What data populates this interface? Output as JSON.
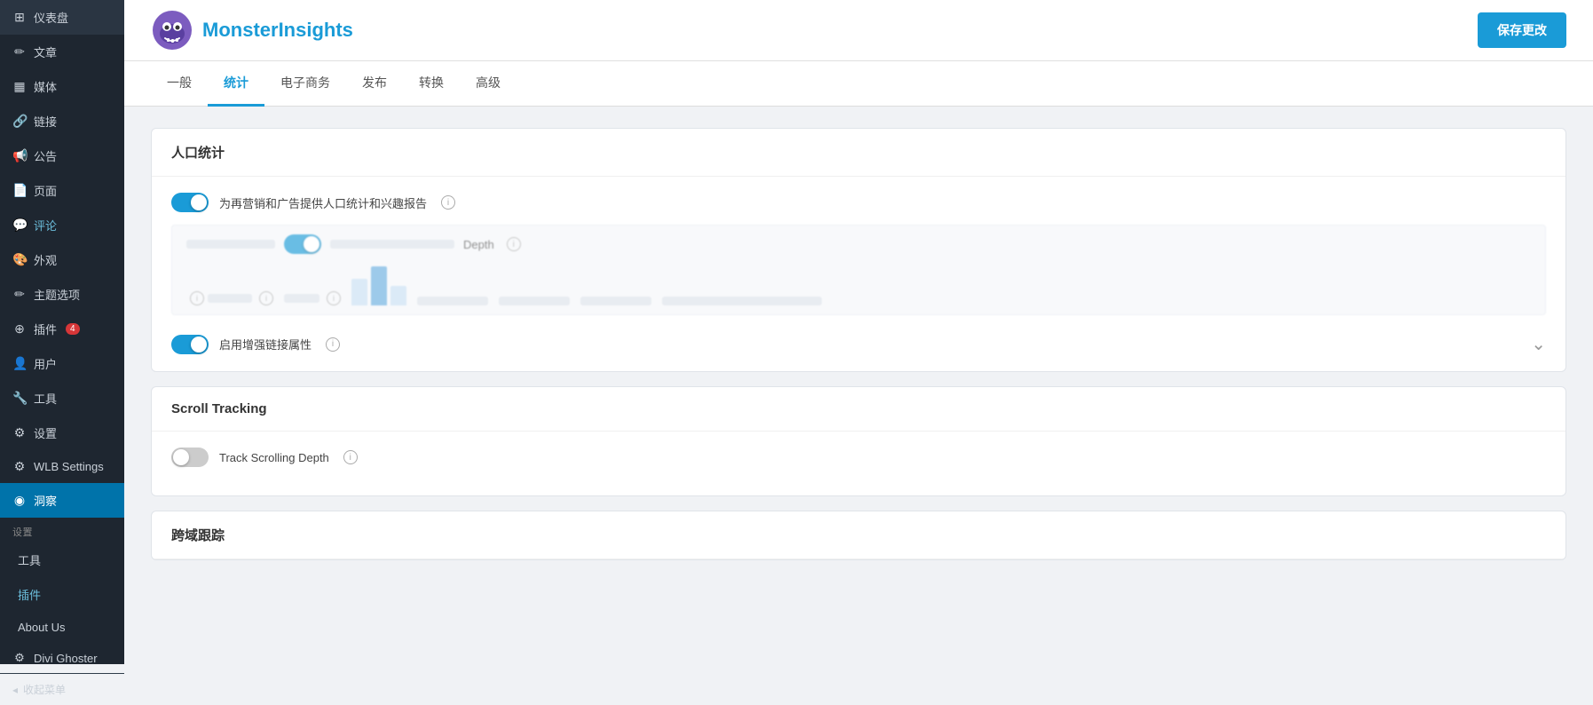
{
  "sidebar": {
    "items": [
      {
        "id": "dashboard",
        "label": "仪表盘",
        "icon": "⊞",
        "active": false
      },
      {
        "id": "articles",
        "label": "文章",
        "icon": "✏",
        "active": false
      },
      {
        "id": "media",
        "label": "媒体",
        "icon": "◫",
        "active": false
      },
      {
        "id": "links",
        "label": "链接",
        "icon": "🔗",
        "active": false
      },
      {
        "id": "announcements",
        "label": "公告",
        "icon": "📢",
        "active": false
      },
      {
        "id": "pages",
        "label": "页面",
        "icon": "📄",
        "active": false
      },
      {
        "id": "comments",
        "label": "评论",
        "icon": "💬",
        "active": false
      },
      {
        "id": "appearance",
        "label": "外观",
        "icon": "🎨",
        "active": false
      },
      {
        "id": "theme-options",
        "label": "主题选项",
        "icon": "✏",
        "active": false
      },
      {
        "id": "plugins",
        "label": "插件",
        "icon": "⊕",
        "badge": "4",
        "active": false
      },
      {
        "id": "users",
        "label": "用户",
        "icon": "👤",
        "active": false
      },
      {
        "id": "tools",
        "label": "工具",
        "icon": "🔧",
        "active": false
      },
      {
        "id": "settings",
        "label": "设置",
        "icon": "⚙",
        "active": false
      },
      {
        "id": "wlb-settings",
        "label": "WLB Settings",
        "icon": "⚙",
        "active": false
      },
      {
        "id": "insights",
        "label": "洞察",
        "icon": "◉",
        "active": true
      }
    ],
    "settings_section": "设置",
    "sub_items": [
      {
        "id": "tools-sub",
        "label": "工具"
      },
      {
        "id": "plugins-sub",
        "label": "插件"
      },
      {
        "id": "about-us",
        "label": "About Us"
      }
    ],
    "footer_items": [
      {
        "id": "divi-ghoster",
        "label": "Divi Ghoster",
        "icon": "⚙"
      },
      {
        "id": "collapse",
        "label": "收起菜单",
        "icon": "◂"
      }
    ]
  },
  "header": {
    "logo_alt": "Monster Insights Logo",
    "logo_text_part1": "Monster",
    "logo_text_part2": "Insights",
    "save_button_label": "保存更改"
  },
  "tabs": [
    {
      "id": "general",
      "label": "一般",
      "active": false
    },
    {
      "id": "statistics",
      "label": "统计",
      "active": true
    },
    {
      "id": "ecommerce",
      "label": "电子商务",
      "active": false
    },
    {
      "id": "publish",
      "label": "发布",
      "active": false
    },
    {
      "id": "conversion",
      "label": "转换",
      "active": false
    },
    {
      "id": "advanced",
      "label": "高级",
      "active": false
    }
  ],
  "cards": {
    "demographics": {
      "title": "人口统计",
      "toggle_label": "为再营销和广告提供人口统计和兴趣报告",
      "toggle_on": true,
      "depth_label": "Depth",
      "enhanced_link_label": "启用增强链接属性",
      "enhanced_link_on": true
    },
    "scroll_tracking": {
      "title": "Scroll Tracking",
      "track_depth_label": "Track Scrolling Depth",
      "track_depth_on": false
    },
    "cross_domain": {
      "title": "跨域跟踪"
    }
  },
  "colors": {
    "accent": "#1a9bd7",
    "toggle_on": "#1a9bd7",
    "toggle_off": "#ccc",
    "save_btn": "#1a9bd7"
  }
}
